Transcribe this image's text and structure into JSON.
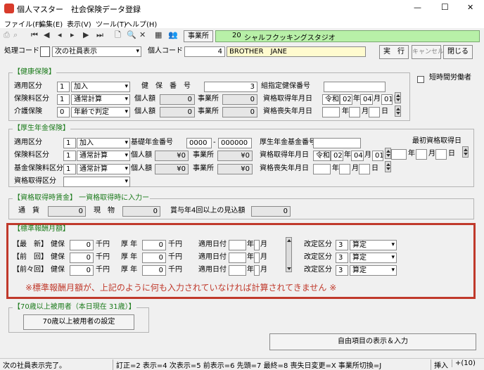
{
  "window": {
    "title": "個人マスター　社会保険データ登録",
    "min": "—",
    "max": "☐",
    "close": "✕"
  },
  "menu": [
    "ファイル(F)",
    "編集(E)",
    "表示(V)",
    "ツール(T)",
    "ヘルプ(H)"
  ],
  "toolbar": {
    "office_label": "事業所",
    "office_no": "20",
    "office_name": "シャルフクッキングスタジオ"
  },
  "top": {
    "proc_label": "処理コード",
    "proc_val": "次の社員表示",
    "code_label": "個人コード",
    "code_val": "4",
    "name_val": "BROTHER　JANE",
    "run": "実　行",
    "cancel": "キャンセル",
    "close": "閉じる"
  },
  "health": {
    "title": "【健康保険】",
    "r1l": "適用区分",
    "r1n": "1",
    "r1s": "加入",
    "insno_label": "健　保　番　号",
    "insno": "3",
    "desig_label": "指定健保番号",
    "designated": "組指定健保番号",
    "r2l": "保険料区分",
    "r2n": "1",
    "r2s": "通常計算",
    "indiv": "個人額",
    "indiv_v": "0",
    "office": "事業所",
    "office_v": "0",
    "acq": "資格取得年月日",
    "era": "令和",
    "y": "02",
    "mo": "04",
    "d": "01",
    "yl": "年",
    "ml": "月",
    "dl": "日",
    "r3l": "介護保険",
    "r3n": "0",
    "r3s": "年齢で判定",
    "loss": "資格喪失年月日",
    "part_time": "短時間労働者"
  },
  "pension": {
    "title": "【厚生年金保険】",
    "r1l": "適用区分",
    "r1n": "1",
    "r1s": "加入",
    "basic": "基礎年金番号",
    "basic1": "0000",
    "dash": "-",
    "basic2": "000000",
    "fund": "厚生年金基金番号",
    "first": "最初資格取得日",
    "r2l": "保険料区分",
    "r2n": "1",
    "r2s": "通常計算",
    "indiv": "個人額",
    "yen": "¥0",
    "office": "事業所",
    "r3l": "基金保険料区分",
    "r3n": "1",
    "r3s": "通常計算",
    "acq": "資格取得年月日",
    "loss": "資格喪失年月日",
    "r4l": "資格取得区分"
  },
  "wage": {
    "title": "【資格取得時賃金】 一資格取得時に入力ー",
    "cur": "通　貨",
    "cur_v": "0",
    "goods": "現　物",
    "goods_v": "0",
    "bonus": "賞与年4回以上の見込額",
    "bonus_v": "0"
  },
  "std": {
    "title": "【標準報酬月額】",
    "rows": [
      {
        "k": "【最　新】"
      },
      {
        "k": "【前　回】"
      },
      {
        "k": "【前々回】"
      }
    ],
    "ken": "健保",
    "zero": "0",
    "sen": "千円",
    "kou": "厚 年",
    "apply": "適用日付",
    "nen": "年",
    "tsuki": "月",
    "rev": "改定区分",
    "rev_n": "3",
    "rev_s": "算定",
    "warn": "※標準報酬月額が、上記のように何も入力されていなければ計算されてきません ※"
  },
  "senior": {
    "title": "【70歳以上被用者（本日現在 31歳）】",
    "btn": "70歳以上被用者の設定"
  },
  "free_btn": "自由項目の表示＆入力",
  "status": {
    "msg": "次の社員表示完了。",
    "keys": "訂正=2 表示=4 次表示=5 前表示=6 先頭=7 最終=8 喪失日変更=X 事業所切換=J",
    "ins": "挿入",
    "num": "+(10)"
  }
}
